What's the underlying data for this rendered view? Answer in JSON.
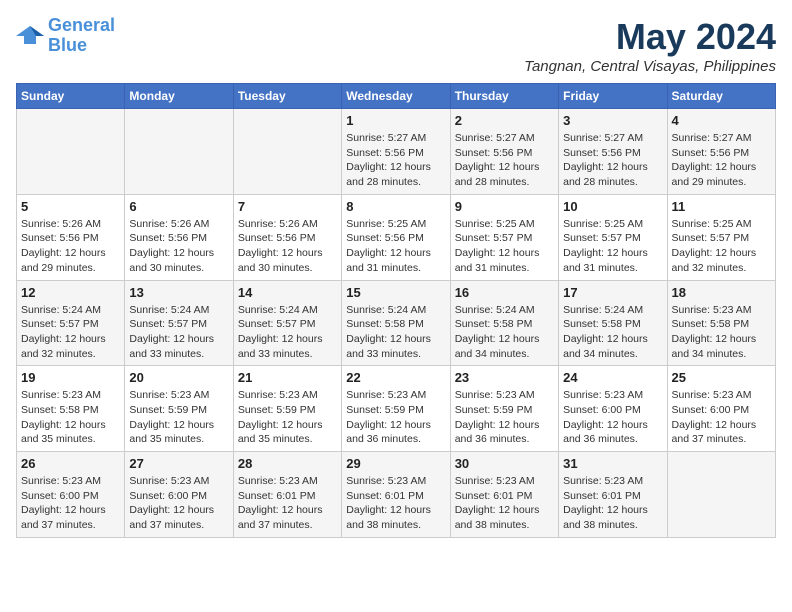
{
  "logo": {
    "line1": "General",
    "line2": "Blue"
  },
  "title": "May 2024",
  "location": "Tangnan, Central Visayas, Philippines",
  "days_header": [
    "Sunday",
    "Monday",
    "Tuesday",
    "Wednesday",
    "Thursday",
    "Friday",
    "Saturday"
  ],
  "weeks": [
    [
      {
        "num": "",
        "info": ""
      },
      {
        "num": "",
        "info": ""
      },
      {
        "num": "",
        "info": ""
      },
      {
        "num": "1",
        "info": "Sunrise: 5:27 AM\nSunset: 5:56 PM\nDaylight: 12 hours\nand 28 minutes."
      },
      {
        "num": "2",
        "info": "Sunrise: 5:27 AM\nSunset: 5:56 PM\nDaylight: 12 hours\nand 28 minutes."
      },
      {
        "num": "3",
        "info": "Sunrise: 5:27 AM\nSunset: 5:56 PM\nDaylight: 12 hours\nand 28 minutes."
      },
      {
        "num": "4",
        "info": "Sunrise: 5:27 AM\nSunset: 5:56 PM\nDaylight: 12 hours\nand 29 minutes."
      }
    ],
    [
      {
        "num": "5",
        "info": "Sunrise: 5:26 AM\nSunset: 5:56 PM\nDaylight: 12 hours\nand 29 minutes."
      },
      {
        "num": "6",
        "info": "Sunrise: 5:26 AM\nSunset: 5:56 PM\nDaylight: 12 hours\nand 30 minutes."
      },
      {
        "num": "7",
        "info": "Sunrise: 5:26 AM\nSunset: 5:56 PM\nDaylight: 12 hours\nand 30 minutes."
      },
      {
        "num": "8",
        "info": "Sunrise: 5:25 AM\nSunset: 5:56 PM\nDaylight: 12 hours\nand 31 minutes."
      },
      {
        "num": "9",
        "info": "Sunrise: 5:25 AM\nSunset: 5:57 PM\nDaylight: 12 hours\nand 31 minutes."
      },
      {
        "num": "10",
        "info": "Sunrise: 5:25 AM\nSunset: 5:57 PM\nDaylight: 12 hours\nand 31 minutes."
      },
      {
        "num": "11",
        "info": "Sunrise: 5:25 AM\nSunset: 5:57 PM\nDaylight: 12 hours\nand 32 minutes."
      }
    ],
    [
      {
        "num": "12",
        "info": "Sunrise: 5:24 AM\nSunset: 5:57 PM\nDaylight: 12 hours\nand 32 minutes."
      },
      {
        "num": "13",
        "info": "Sunrise: 5:24 AM\nSunset: 5:57 PM\nDaylight: 12 hours\nand 33 minutes."
      },
      {
        "num": "14",
        "info": "Sunrise: 5:24 AM\nSunset: 5:57 PM\nDaylight: 12 hours\nand 33 minutes."
      },
      {
        "num": "15",
        "info": "Sunrise: 5:24 AM\nSunset: 5:58 PM\nDaylight: 12 hours\nand 33 minutes."
      },
      {
        "num": "16",
        "info": "Sunrise: 5:24 AM\nSunset: 5:58 PM\nDaylight: 12 hours\nand 34 minutes."
      },
      {
        "num": "17",
        "info": "Sunrise: 5:24 AM\nSunset: 5:58 PM\nDaylight: 12 hours\nand 34 minutes."
      },
      {
        "num": "18",
        "info": "Sunrise: 5:23 AM\nSunset: 5:58 PM\nDaylight: 12 hours\nand 34 minutes."
      }
    ],
    [
      {
        "num": "19",
        "info": "Sunrise: 5:23 AM\nSunset: 5:58 PM\nDaylight: 12 hours\nand 35 minutes."
      },
      {
        "num": "20",
        "info": "Sunrise: 5:23 AM\nSunset: 5:59 PM\nDaylight: 12 hours\nand 35 minutes."
      },
      {
        "num": "21",
        "info": "Sunrise: 5:23 AM\nSunset: 5:59 PM\nDaylight: 12 hours\nand 35 minutes."
      },
      {
        "num": "22",
        "info": "Sunrise: 5:23 AM\nSunset: 5:59 PM\nDaylight: 12 hours\nand 36 minutes."
      },
      {
        "num": "23",
        "info": "Sunrise: 5:23 AM\nSunset: 5:59 PM\nDaylight: 12 hours\nand 36 minutes."
      },
      {
        "num": "24",
        "info": "Sunrise: 5:23 AM\nSunset: 6:00 PM\nDaylight: 12 hours\nand 36 minutes."
      },
      {
        "num": "25",
        "info": "Sunrise: 5:23 AM\nSunset: 6:00 PM\nDaylight: 12 hours\nand 37 minutes."
      }
    ],
    [
      {
        "num": "26",
        "info": "Sunrise: 5:23 AM\nSunset: 6:00 PM\nDaylight: 12 hours\nand 37 minutes."
      },
      {
        "num": "27",
        "info": "Sunrise: 5:23 AM\nSunset: 6:00 PM\nDaylight: 12 hours\nand 37 minutes."
      },
      {
        "num": "28",
        "info": "Sunrise: 5:23 AM\nSunset: 6:01 PM\nDaylight: 12 hours\nand 37 minutes."
      },
      {
        "num": "29",
        "info": "Sunrise: 5:23 AM\nSunset: 6:01 PM\nDaylight: 12 hours\nand 38 minutes."
      },
      {
        "num": "30",
        "info": "Sunrise: 5:23 AM\nSunset: 6:01 PM\nDaylight: 12 hours\nand 38 minutes."
      },
      {
        "num": "31",
        "info": "Sunrise: 5:23 AM\nSunset: 6:01 PM\nDaylight: 12 hours\nand 38 minutes."
      },
      {
        "num": "",
        "info": ""
      }
    ]
  ]
}
